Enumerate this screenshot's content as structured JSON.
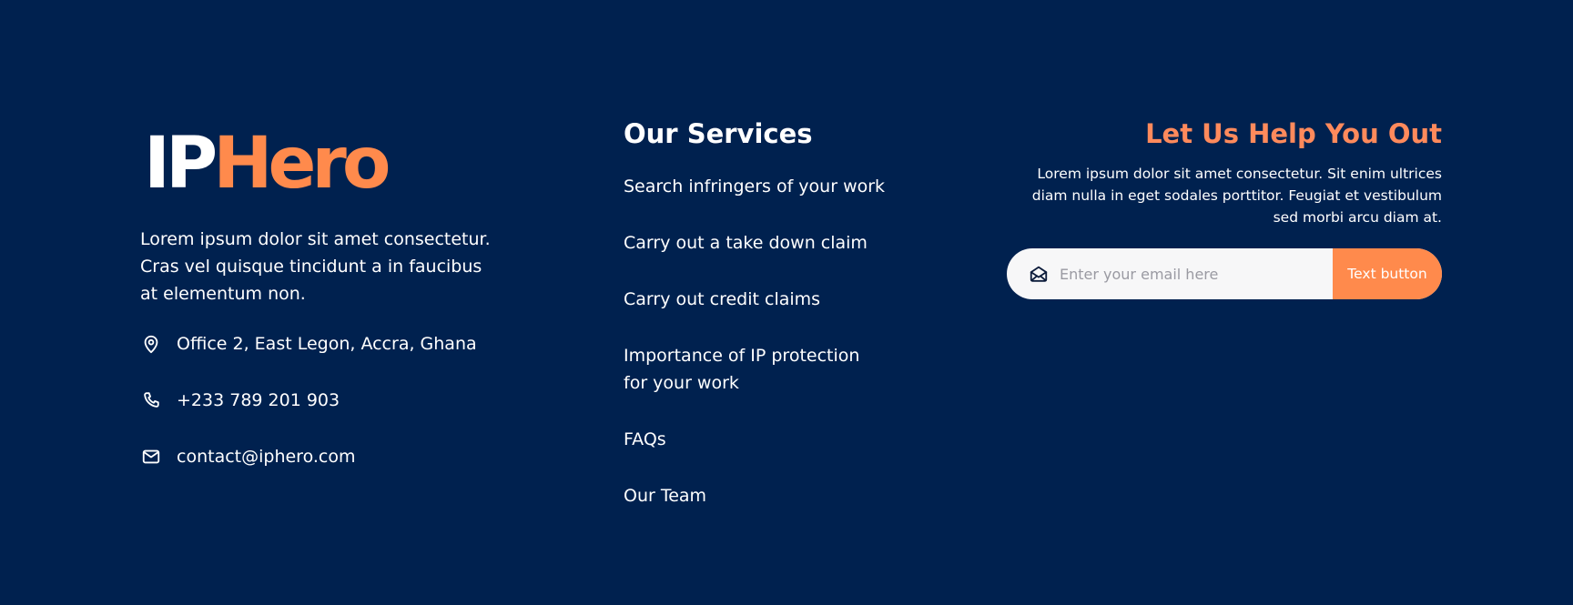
{
  "brand": {
    "logo_part1": "IP",
    "logo_part2": "Hero",
    "description": "Lorem ipsum dolor sit amet consectetur. Cras vel quisque tincidunt a in faucibus at elementum non.",
    "contacts": [
      {
        "icon": "map-pin-icon",
        "text": "Office 2, East Legon, Accra, Ghana"
      },
      {
        "icon": "phone-icon",
        "text": "+233 789 201 903"
      },
      {
        "icon": "mail-icon",
        "text": "contact@iphero.com"
      }
    ]
  },
  "services": {
    "title": "Our Services",
    "items": [
      "Search infringers of your work",
      "Carry out a take down claim",
      "Carry out credit claims",
      "Importance of IP protection for your work",
      "FAQs",
      "Our Team"
    ]
  },
  "help": {
    "title": "Let Us Help You Out",
    "description": "Lorem ipsum dolor sit amet consectetur. Sit enim ultrices diam nulla in eget sodales porttitor. Feugiat et vestibulum sed morbi arcu diam at.",
    "email_placeholder": "Enter your email here",
    "email_value": "",
    "button_label": "Text button",
    "input_icon": "open-envelope-icon"
  },
  "colors": {
    "background": "#00214f",
    "accent": "#ff8a4c",
    "help_title": "#ff8a5c",
    "text": "#ffffff"
  }
}
